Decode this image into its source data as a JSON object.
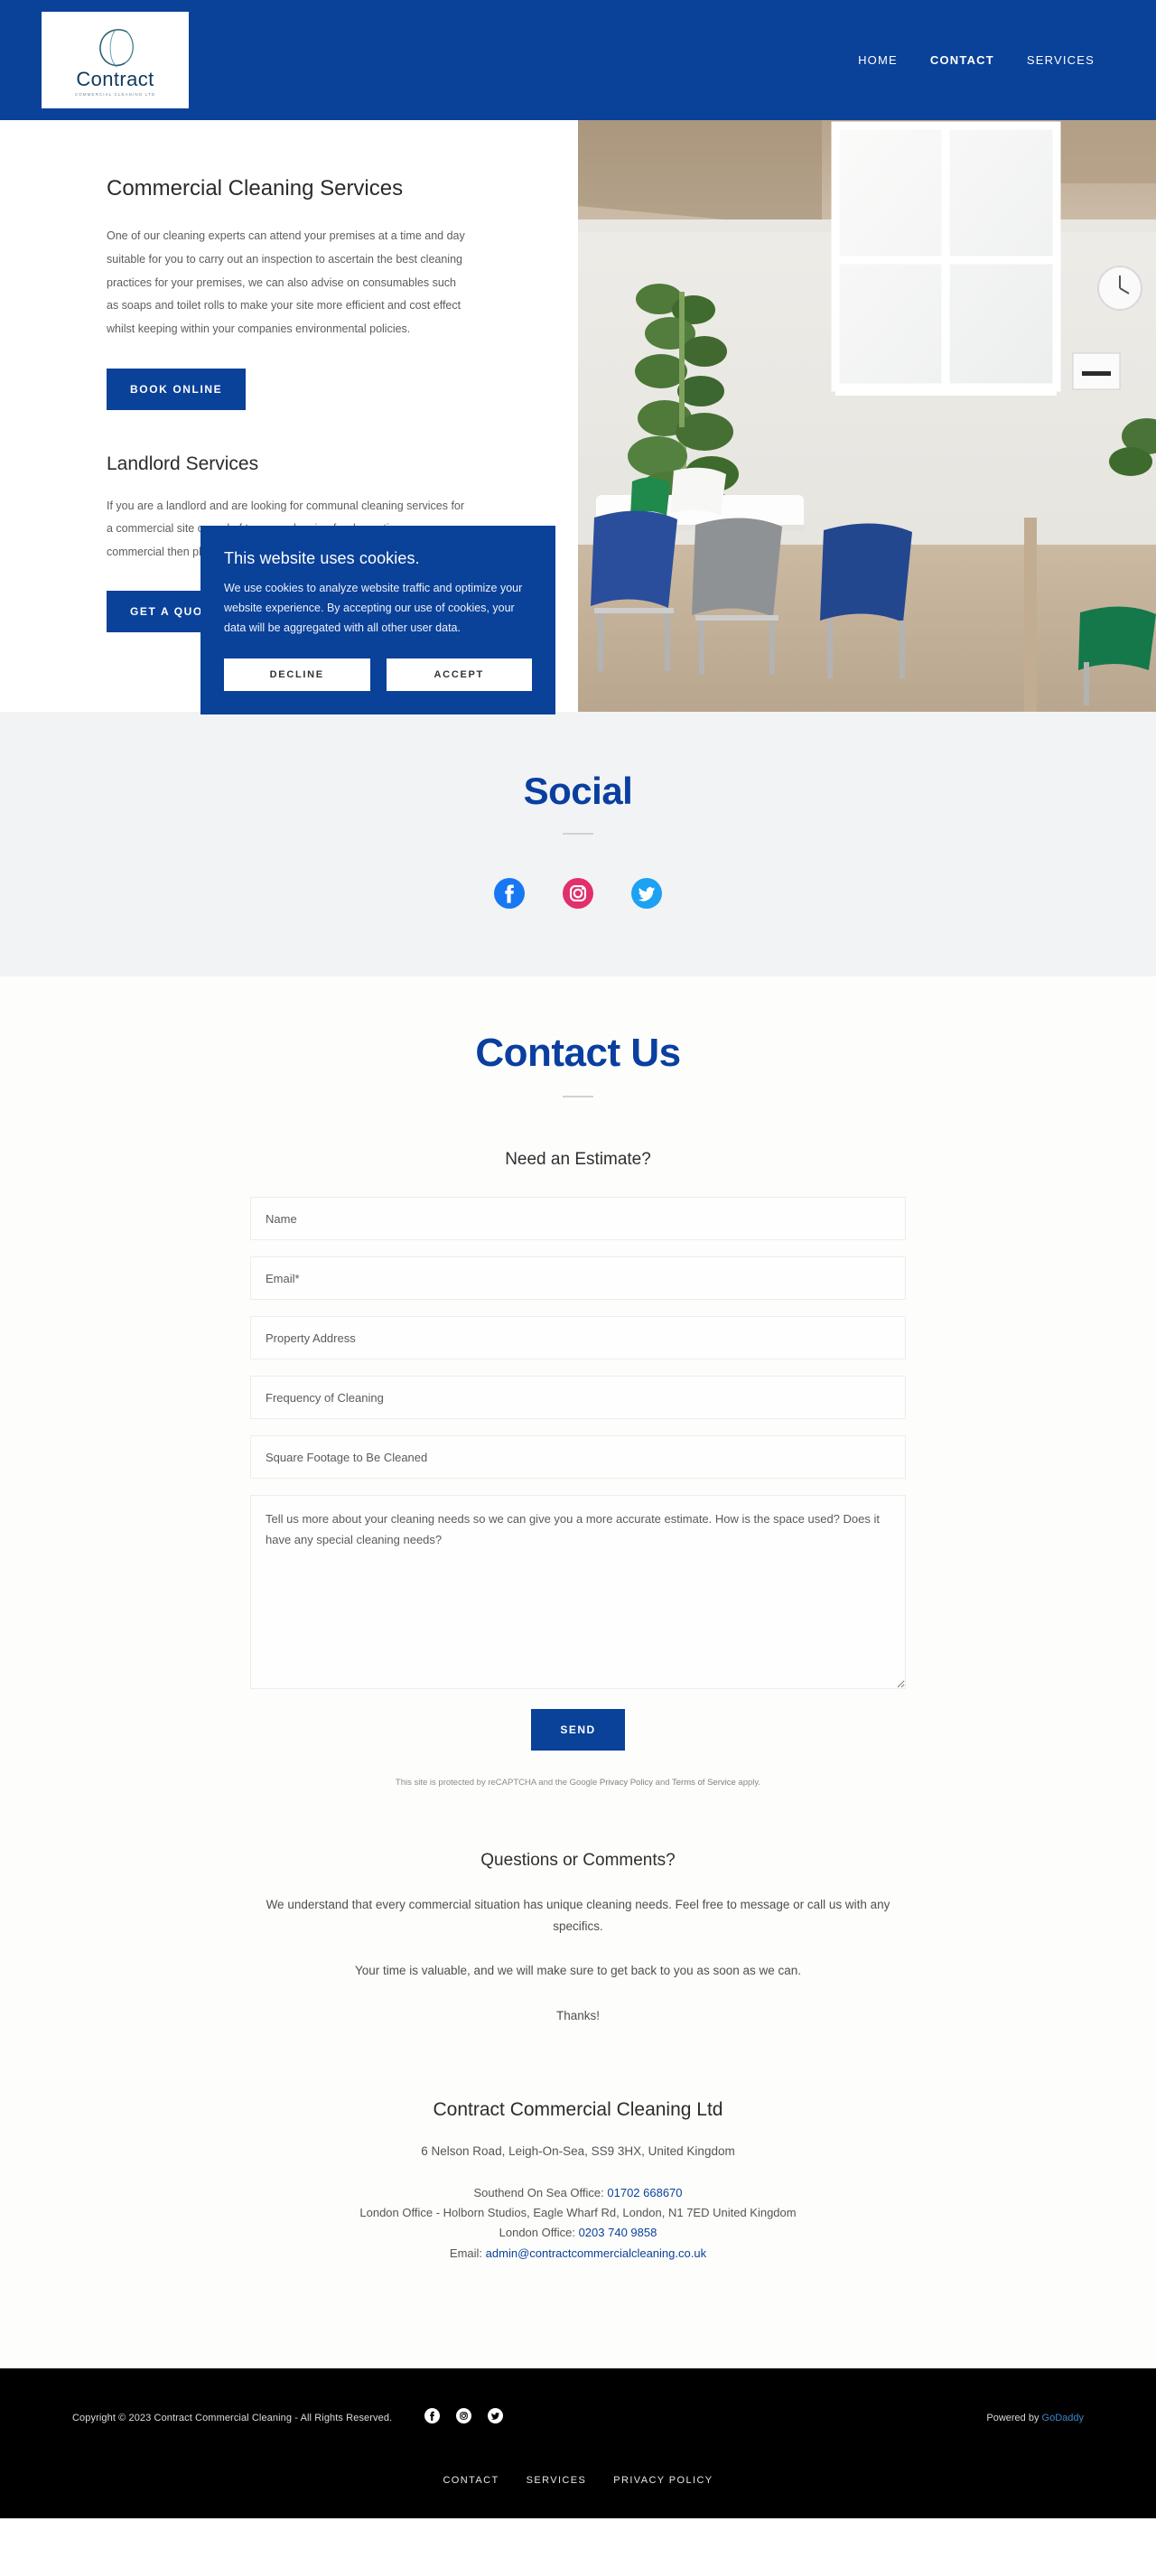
{
  "header": {
    "logo": {
      "word": "Contract",
      "sub": "Commercial Cleaning Ltd",
      "mark": "script-c-logo"
    },
    "nav": [
      {
        "label": "HOME",
        "active": false
      },
      {
        "label": "CONTACT",
        "active": true
      },
      {
        "label": "SERVICES",
        "active": false
      }
    ]
  },
  "hero": {
    "heading1": "Commercial Cleaning Services",
    "para1": "One of our cleaning experts can attend your premises at a time and day suitable for you to carry out an inspection to ascertain the best cleaning practices for your premises, we can also advise on consumables such as soaps and toilet rolls to make your site more efficient and cost effect whilst keeping within your companies environmental policies.",
    "button1": "BOOK ONLINE",
    "heading2": "Landlord Services",
    "para2": "If you are a landlord and are looking for communal cleaning services for a commercial site or end of tenancy cleaning for domestic or commercial then please do not hesitate to contact us!",
    "button2": "GET A QUOTE",
    "image_alt": "office-meeting-room-photo"
  },
  "cookie": {
    "title": "This website uses cookies.",
    "body": "We use cookies to analyze website traffic and optimize your website experience. By accepting our use of cookies, your data will be aggregated with all other user data.",
    "decline": "DECLINE",
    "accept": "ACCEPT"
  },
  "social": {
    "title": "Social",
    "icons": [
      "facebook-icon",
      "instagram-icon",
      "twitter-icon"
    ]
  },
  "contact": {
    "title": "Contact Us",
    "subtitle": "Need an Estimate?",
    "fields": [
      {
        "name": "name",
        "placeholder": "Name"
      },
      {
        "name": "email",
        "placeholder": "Email*"
      },
      {
        "name": "property-address",
        "placeholder": "Property Address"
      },
      {
        "name": "frequency",
        "placeholder": "Frequency of Cleaning"
      },
      {
        "name": "square-footage",
        "placeholder": "Square Footage to Be Cleaned"
      }
    ],
    "textarea_placeholder": "Tell us more about your cleaning needs so we can give you a more accurate estimate. How is the space used? Does it have any special cleaning needs?",
    "send_label": "SEND",
    "recaptcha": {
      "pre": "This site is protected by reCAPTCHA and the Google ",
      "privacy": "Privacy Policy",
      "mid": " and ",
      "terms": "Terms of Service",
      "post": " apply."
    },
    "questions_title": "Questions or Comments?",
    "questions_p1": "We understand that every commercial situation has unique cleaning needs. Feel free to message or call us with any specifics.",
    "questions_p2": "Your time is valuable, and we will make sure to get back to you as soon as we can.",
    "questions_p3": "Thanks!",
    "company": "Contract Commercial Cleaning Ltd",
    "address": "6 Nelson Road, Leigh-On-Sea, SS9 3HX, United Kingdom",
    "southend_label": "Southend On Sea Office: ",
    "southend_phone": "01702 668670",
    "london_address": "London Office - Holborn Studios, Eagle Wharf Rd, London, N1 7ED United Kingdom",
    "london_label": "London Office: ",
    "london_phone": "0203 740 9858",
    "email_label": "Email: ",
    "email": "admin@contractcommercialcleaning.co.uk"
  },
  "footer": {
    "copyright": "Copyright © 2023 Contract Commercial Cleaning - All Rights Reserved.",
    "icons": [
      "facebook-icon",
      "instagram-icon",
      "twitter-icon"
    ],
    "powered_pre": "Powered by ",
    "powered_brand": "GoDaddy",
    "nav": [
      {
        "label": "CONTACT"
      },
      {
        "label": "SERVICES"
      },
      {
        "label": "PRIVACY POLICY"
      }
    ]
  },
  "colors": {
    "brand_blue": "#0a4199",
    "social_bg": "#f2f3f5",
    "footer_bg": "#000000",
    "facebook": "#1877f2",
    "instagram": "#e1306c",
    "twitter": "#1da1f2"
  }
}
